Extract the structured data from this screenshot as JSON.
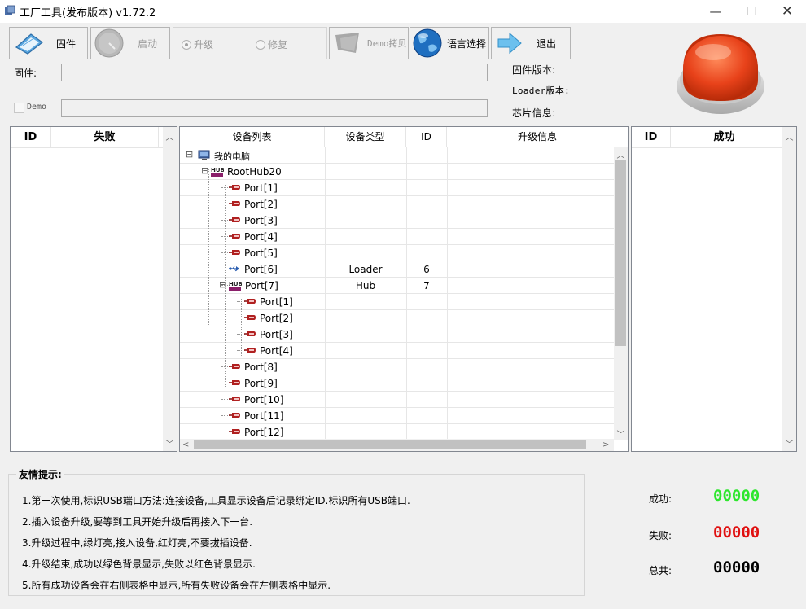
{
  "app": {
    "title": "工厂工具(发布版本) v1.72.2",
    "window_controls": {
      "minimize": "—",
      "maximize": "☐",
      "close": "✕"
    }
  },
  "toolbar": {
    "firmware_label": "固件",
    "start_label": "启动",
    "upgrade_label": "升级",
    "repair_label": "修复",
    "demo_copy_label": "Demo拷贝",
    "language_label": "语言选择",
    "exit_label": "退出",
    "upgrade_selected": true
  },
  "fields": {
    "firmware_label": "固件:",
    "firmware_value": "",
    "demo_label": "Demo",
    "demo_value": "",
    "demo_checked": false
  },
  "info": {
    "firmware_version_label": "固件版本:",
    "loader_version_label": "Loader版本:",
    "chip_info_label": "芯片信息:"
  },
  "fail_list": {
    "columns": [
      "ID",
      "失败"
    ],
    "rows": []
  },
  "success_list": {
    "columns": [
      "ID",
      "成功"
    ],
    "rows": []
  },
  "device_tree": {
    "columns": [
      "设备列表",
      "设备类型",
      "ID",
      "升级信息"
    ],
    "rows": [
      {
        "label": "我的电脑",
        "icon": "computer-icon",
        "level": 0,
        "expander": "⊟",
        "type": "",
        "id": ""
      },
      {
        "label": "RootHub20",
        "icon": "hub-icon",
        "level": 1,
        "expander": "⊟",
        "type": "",
        "id": ""
      },
      {
        "label": "Port[1]",
        "icon": "usb-port-icon",
        "level": 2,
        "type": "",
        "id": ""
      },
      {
        "label": "Port[2]",
        "icon": "usb-port-icon",
        "level": 2,
        "type": "",
        "id": ""
      },
      {
        "label": "Port[3]",
        "icon": "usb-port-icon",
        "level": 2,
        "type": "",
        "id": ""
      },
      {
        "label": "Port[4]",
        "icon": "usb-port-icon",
        "level": 2,
        "type": "",
        "id": ""
      },
      {
        "label": "Port[5]",
        "icon": "usb-port-icon",
        "level": 2,
        "type": "",
        "id": ""
      },
      {
        "label": "Port[6]",
        "icon": "usb-device-icon",
        "level": 2,
        "type": "Loader",
        "id": "6"
      },
      {
        "label": "Port[7]",
        "icon": "hub-icon",
        "level": 2,
        "expander": "⊟",
        "type": "Hub",
        "id": "7"
      },
      {
        "label": "Port[1]",
        "icon": "usb-port-icon",
        "level": 3,
        "type": "",
        "id": ""
      },
      {
        "label": "Port[2]",
        "icon": "usb-port-icon",
        "level": 3,
        "type": "",
        "id": ""
      },
      {
        "label": "Port[3]",
        "icon": "usb-port-icon",
        "level": 3,
        "type": "",
        "id": ""
      },
      {
        "label": "Port[4]",
        "icon": "usb-port-icon",
        "level": 3,
        "type": "",
        "id": ""
      },
      {
        "label": "Port[8]",
        "icon": "usb-port-icon",
        "level": 2,
        "type": "",
        "id": ""
      },
      {
        "label": "Port[9]",
        "icon": "usb-port-icon",
        "level": 2,
        "type": "",
        "id": ""
      },
      {
        "label": "Port[10]",
        "icon": "usb-port-icon",
        "level": 2,
        "type": "",
        "id": ""
      },
      {
        "label": "Port[11]",
        "icon": "usb-port-icon",
        "level": 2,
        "type": "",
        "id": ""
      },
      {
        "label": "Port[12]",
        "icon": "usb-port-icon",
        "level": 2,
        "type": "",
        "id": ""
      }
    ]
  },
  "hints": {
    "title": "友情提示:",
    "items": [
      "1.第一次使用,标识USB端口方法:连接设备,工具显示设备后记录绑定ID.标识所有USB端口.",
      "2.插入设备升级,要等到工具开始升级后再接入下一台.",
      "3.升级过程中,绿灯亮,接入设备,红灯亮,不要拔插设备.",
      "4.升级结束,成功以绿色背景显示,失败以红色背景显示.",
      "5.所有成功设备会在右侧表格中显示,所有失败设备会在左侧表格中显示."
    ]
  },
  "stats": {
    "success_label": "成功:",
    "success_value": "00000",
    "fail_label": "失败:",
    "fail_value": "00000",
    "total_label": "总共:",
    "total_value": "00000"
  },
  "colors": {
    "success": "#2ee62e",
    "fail": "#e01010",
    "total": "#000000",
    "status_light": "#e8421a"
  }
}
